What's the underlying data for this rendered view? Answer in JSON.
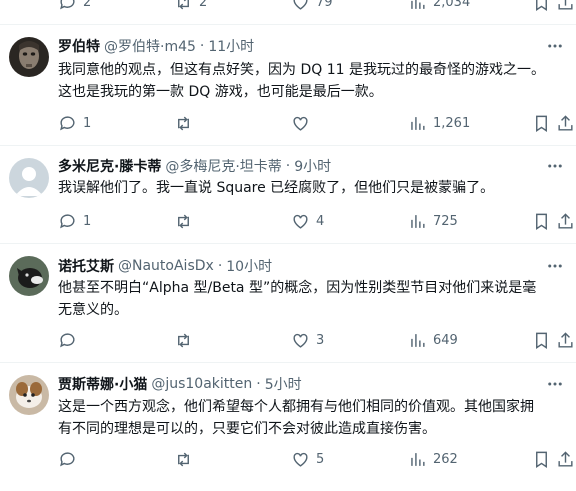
{
  "top_stats": {
    "replies": "2",
    "retweets": "2",
    "likes": "79",
    "views": "2,034"
  },
  "tweets": [
    {
      "name": "罗伯特",
      "handle": "@罗伯特·m45",
      "time": "11小时",
      "text": "我同意他的观点，但这有点好笑，因为 DQ 11 是我玩过的最奇怪的游戏之一。\n这也是我玩的第一款 DQ 游戏，也可能是最后一款。",
      "replies": "1",
      "retweets": "",
      "likes": "",
      "views": "1,261"
    },
    {
      "name": "多米尼克·滕卡蒂",
      "handle": "@多梅尼克·坦卡蒂",
      "time": "9小时",
      "text": "我误解他们了。我一直说 Square 已经腐败了，但他们只是被蒙骗了。",
      "replies": "1",
      "retweets": "",
      "likes": "4",
      "views": "725"
    },
    {
      "name": "诺托艾斯",
      "handle": "@NautoAisDx",
      "time": "10小时",
      "text": "他甚至不明白“Alpha 型/Beta 型”的概念，因为性别类型节目对他们来说是毫\n无意义的。",
      "replies": "",
      "retweets": "",
      "likes": "3",
      "views": "649"
    },
    {
      "name": "贾斯蒂娜·小猫",
      "handle": "@jus10akitten",
      "time": "5小时",
      "text": "这是一个西方观念，他们希望每个人都拥有与他们相同的价值观。其他国家拥\n有不同的理想是可以的，只要它们不会对彼此造成直接伤害。",
      "replies": "",
      "retweets": "",
      "likes": "5",
      "views": "262"
    }
  ],
  "icons": {
    "reply": "reply-icon",
    "retweet": "retweet-icon",
    "like": "heart-icon",
    "views": "views-icon",
    "bookmark": "bookmark-icon",
    "share": "share-icon",
    "more": "more-icon"
  },
  "colors": {
    "secondary_text": "#536471",
    "divider": "#eff3f4"
  }
}
